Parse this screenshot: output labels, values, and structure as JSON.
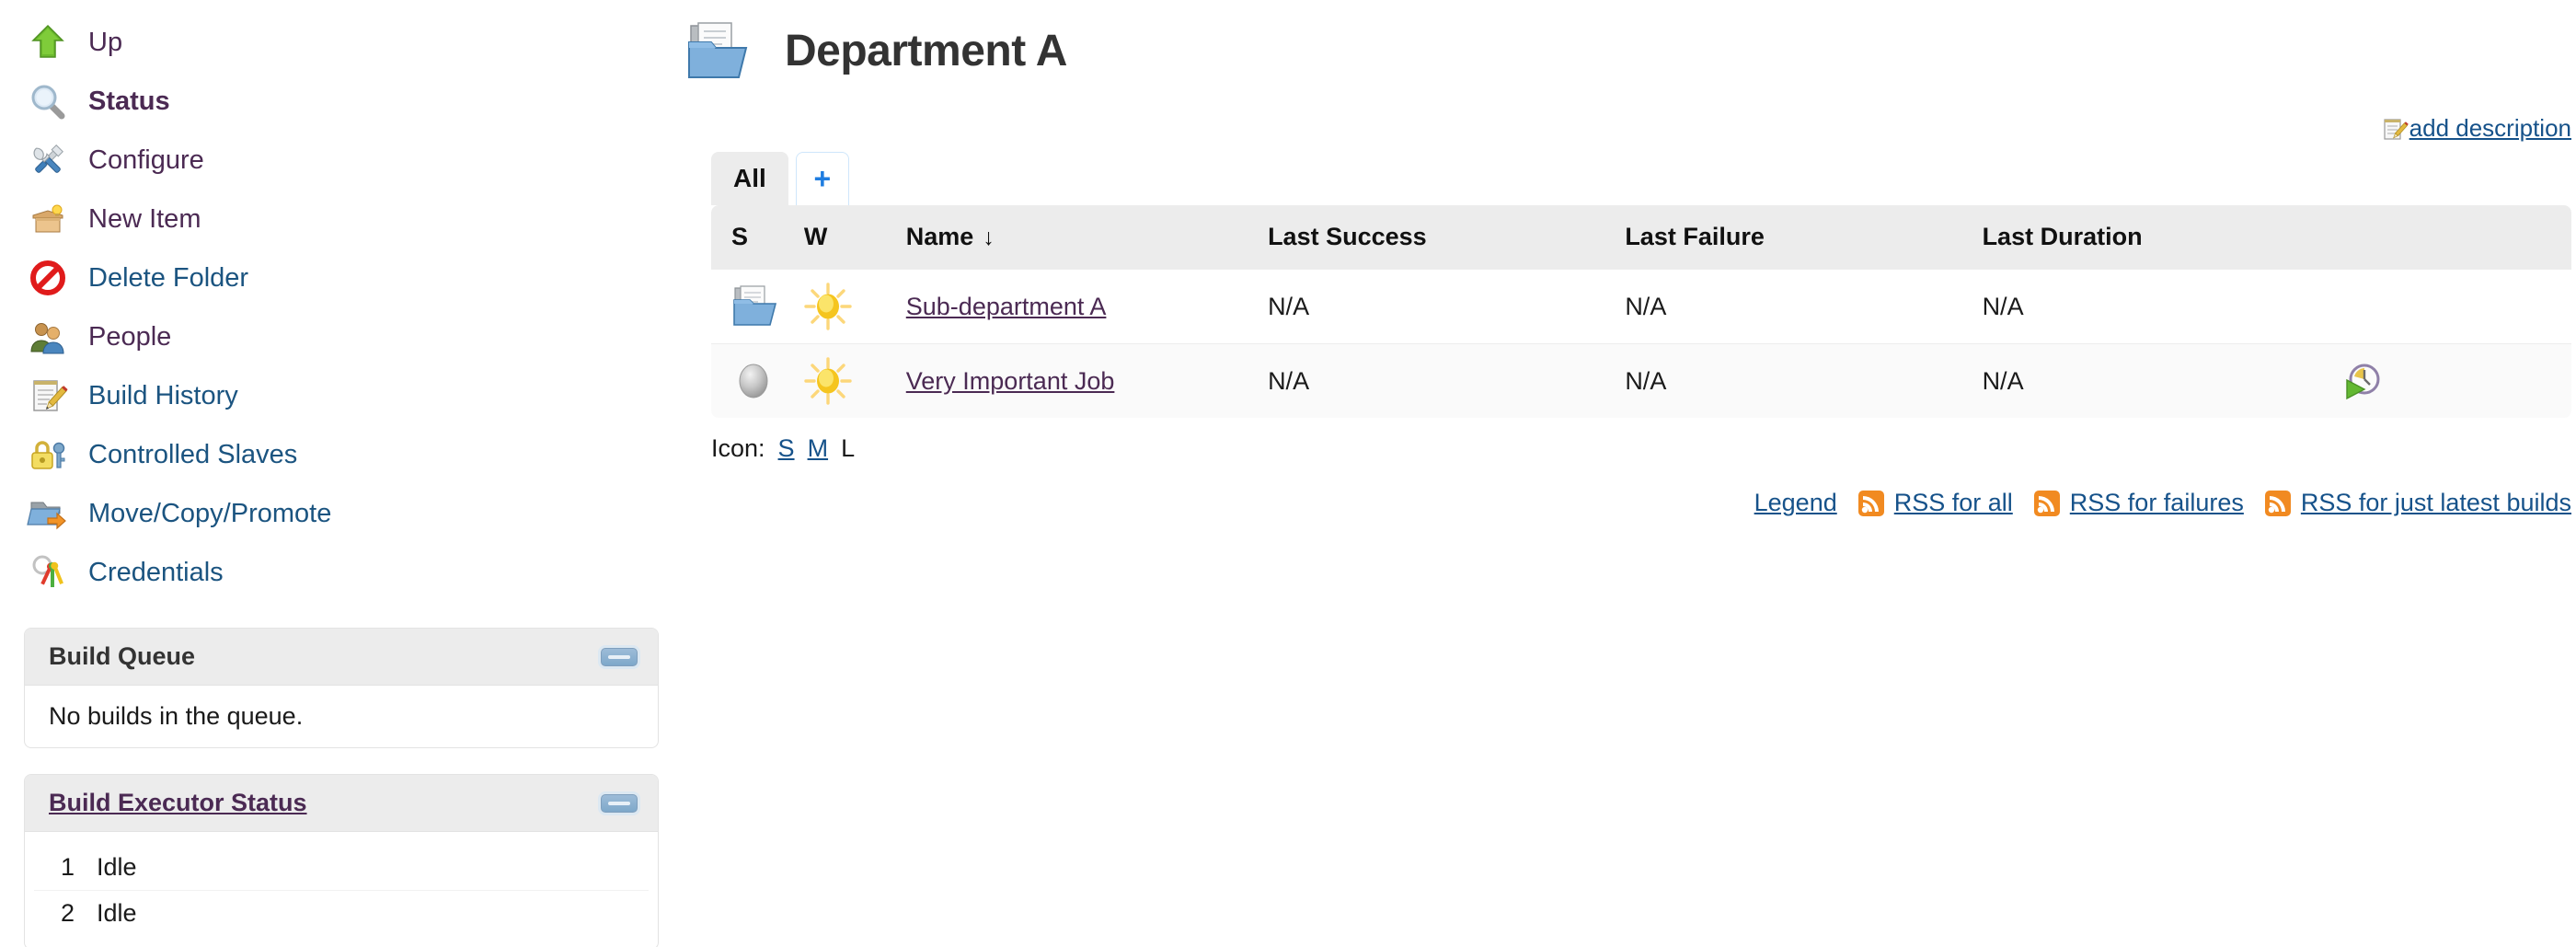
{
  "sidebar": {
    "tasks": [
      {
        "label": "Up",
        "icon": "up-arrow-icon",
        "style": "purple"
      },
      {
        "label": "Status",
        "icon": "magnifier-icon",
        "style": "bold"
      },
      {
        "label": "Configure",
        "icon": "wrench-screwdriver-icon",
        "style": "purple"
      },
      {
        "label": "New Item",
        "icon": "new-item-box-icon",
        "style": "purple"
      },
      {
        "label": "Delete Folder",
        "icon": "delete-forbidden-icon",
        "style": "blue"
      },
      {
        "label": "People",
        "icon": "people-icon",
        "style": "purple"
      },
      {
        "label": "Build History",
        "icon": "notepad-pencil-icon",
        "style": "blue"
      },
      {
        "label": "Controlled Slaves",
        "icon": "lock-key-icon",
        "style": "blue"
      },
      {
        "label": "Move/Copy/Promote",
        "icon": "folder-arrow-icon",
        "style": "blue"
      },
      {
        "label": "Credentials",
        "icon": "keyring-icon",
        "style": "blue"
      }
    ],
    "build_queue": {
      "title": "Build Queue",
      "empty_text": "No builds in the queue.",
      "collapse_icon": "collapse-minus-icon"
    },
    "build_executor_status": {
      "title": "Build Executor Status",
      "collapse_icon": "collapse-minus-icon",
      "executors": [
        {
          "number": "1",
          "status": "Idle"
        },
        {
          "number": "2",
          "status": "Idle"
        }
      ]
    }
  },
  "main": {
    "title": "Department A",
    "title_icon": "folder-documents-icon",
    "add_description": {
      "label": "add description",
      "icon": "notepad-pencil-icon"
    },
    "tabs": [
      {
        "label": "All",
        "active": true
      },
      {
        "label": "+",
        "active": false
      }
    ],
    "table": {
      "columns": [
        "S",
        "W",
        "Name",
        "Last Success",
        "Last Failure",
        "Last Duration"
      ],
      "sorted_column": "Name",
      "sort_indicator": "↓",
      "rows": [
        {
          "status_icon": "folder-blue-icon",
          "weather_icon": "sunny-icon",
          "name": "Sub-department A",
          "last_success": "N/A",
          "last_failure": "N/A",
          "last_duration": "N/A",
          "action_icon": ""
        },
        {
          "status_icon": "grey-ball-icon",
          "weather_icon": "sunny-icon",
          "name": "Very Important Job",
          "last_success": "N/A",
          "last_failure": "N/A",
          "last_duration": "N/A",
          "action_icon": "schedule-build-icon"
        }
      ]
    },
    "icon_size": {
      "label": "Icon:",
      "options": [
        {
          "label": "S",
          "selected": false
        },
        {
          "label": "M",
          "selected": false
        },
        {
          "label": "L",
          "selected": true
        }
      ]
    },
    "footer_links": [
      {
        "label": "Legend",
        "icon": ""
      },
      {
        "label": "RSS for all",
        "icon": "rss-icon"
      },
      {
        "label": "RSS for failures",
        "icon": "rss-icon"
      },
      {
        "label": "RSS for just latest builds",
        "icon": "rss-icon"
      }
    ]
  },
  "colors": {
    "link_blue": "#16528a",
    "link_purple": "#4b2a53",
    "header_grey": "#ececec",
    "rss_orange": "#f18a21",
    "tab_add_blue": "#1f7de0"
  }
}
